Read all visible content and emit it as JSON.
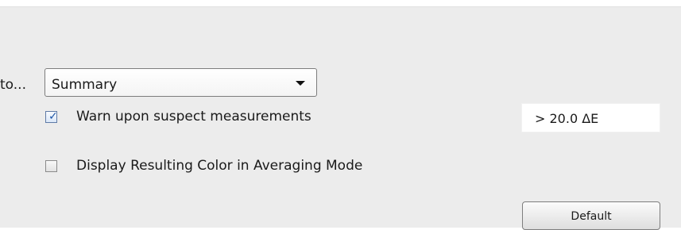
{
  "left_label": "to...",
  "output_select": {
    "value": "Summary"
  },
  "options": {
    "warn_suspect": {
      "label": "Warn upon suspect measurements",
      "checked": true
    },
    "display_resulting_color": {
      "label": "Display Resulting Color in Averaging Mode",
      "checked": false
    }
  },
  "threshold": {
    "value": "> 20.0 ΔE"
  },
  "buttons": {
    "default_label": "Default"
  },
  "icons": {
    "dropdown": "chevron-down-icon",
    "check": "checkmark-icon"
  },
  "colors": {
    "panel_bg": "#ececec",
    "checkmark": "#1f56a7"
  }
}
